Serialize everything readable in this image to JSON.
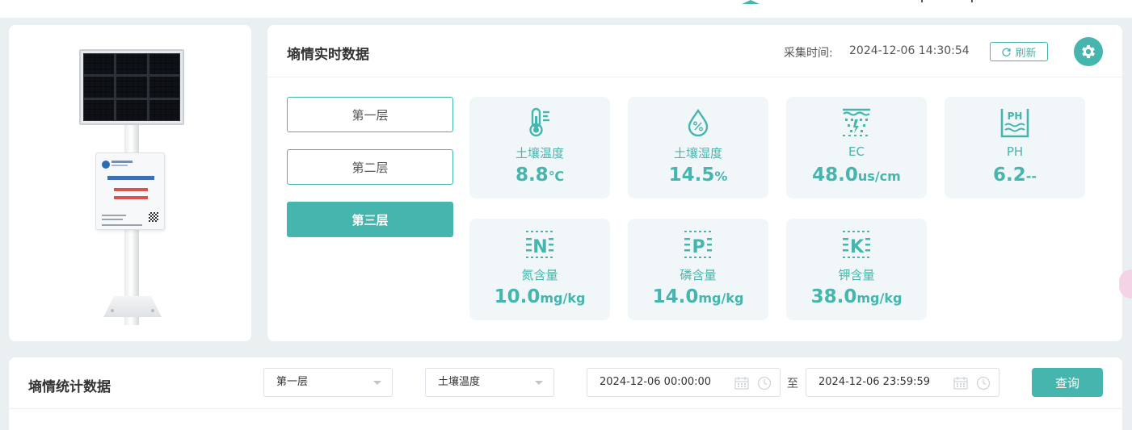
{
  "realtime": {
    "title": "墒情实时数据",
    "collect_label": "采集时间:",
    "collect_time": "2024-12-06 14:30:54",
    "refresh_label": "刷新",
    "layers": [
      "第一层",
      "第二层",
      "第三层"
    ],
    "active_layer": "第三层",
    "metrics": [
      {
        "icon": "thermometer-icon",
        "label": "土壤温度",
        "value": "8.8",
        "unit": "℃"
      },
      {
        "icon": "humidity-drop-icon",
        "label": "土壤湿度",
        "value": "14.5",
        "unit": "%"
      },
      {
        "icon": "ec-icon",
        "label": "EC",
        "value": "48.0",
        "unit": "us/cm"
      },
      {
        "icon": "ph-icon",
        "label": "PH",
        "value": "6.2",
        "unit": "--"
      },
      {
        "icon": "nitrogen-icon",
        "label": "氮含量",
        "value": "10.0",
        "unit": "mg/kg"
      },
      {
        "icon": "phosphorus-icon",
        "label": "磷含量",
        "value": "14.0",
        "unit": "mg/kg"
      },
      {
        "icon": "potassium-icon",
        "label": "钾含量",
        "value": "38.0",
        "unit": "mg/kg"
      }
    ]
  },
  "statistics": {
    "title": "墒情统计数据",
    "layer_select": "第一层",
    "param_select": "土壤温度",
    "start_time": "2024-12-06 00:00:00",
    "range_separator": "至",
    "end_time": "2024-12-06 23:59:59",
    "query_label": "查询"
  },
  "colors": {
    "accent": "#45b5ae",
    "page_bg": "#eaf0f2",
    "metric_bg": "#f1f7f8"
  }
}
